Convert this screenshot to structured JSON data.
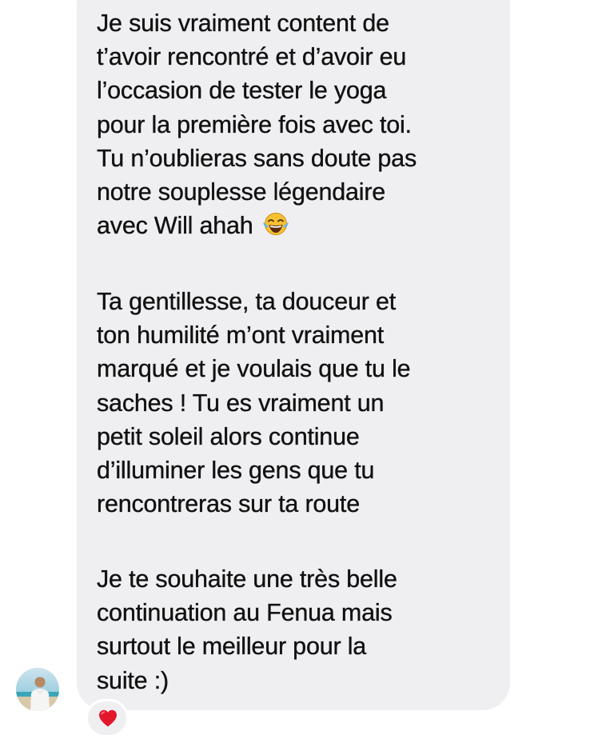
{
  "message": {
    "paragraphs": [
      {
        "lines": [
          "Je suis vraiment content de",
          "t’avoir rencontré et d’avoir eu",
          "l’occasion de tester le yoga",
          "pour la première fois avec toi.",
          "Tu n’oublieras sans doute pas",
          "notre souplesse légendaire",
          "avec Will ahah "
        ]
      },
      {
        "lines": [
          "Ta gentillesse, ta douceur et",
          "ton humilité m’ont vraiment",
          "marqué et je voulais que tu le",
          "saches ! Tu es vraiment un",
          "petit soleil alors continue",
          "d’illuminer les gens que tu",
          "rencontreras sur ta route"
        ]
      },
      {
        "lines": [
          "Je te souhaite une très belle",
          "continuation au Fenua mais",
          "surtout le meilleur pour la",
          "suite :)"
        ]
      }
    ],
    "inline_emoji": "face-with-tears-of-joy-emoji"
  },
  "sender": {
    "avatar": "profile-avatar-photo"
  },
  "reaction": {
    "emoji": "red-heart-icon",
    "color": "#e3162b"
  },
  "colors": {
    "bubble": "#efeff2",
    "text": "#111111",
    "background": "#ffffff"
  }
}
